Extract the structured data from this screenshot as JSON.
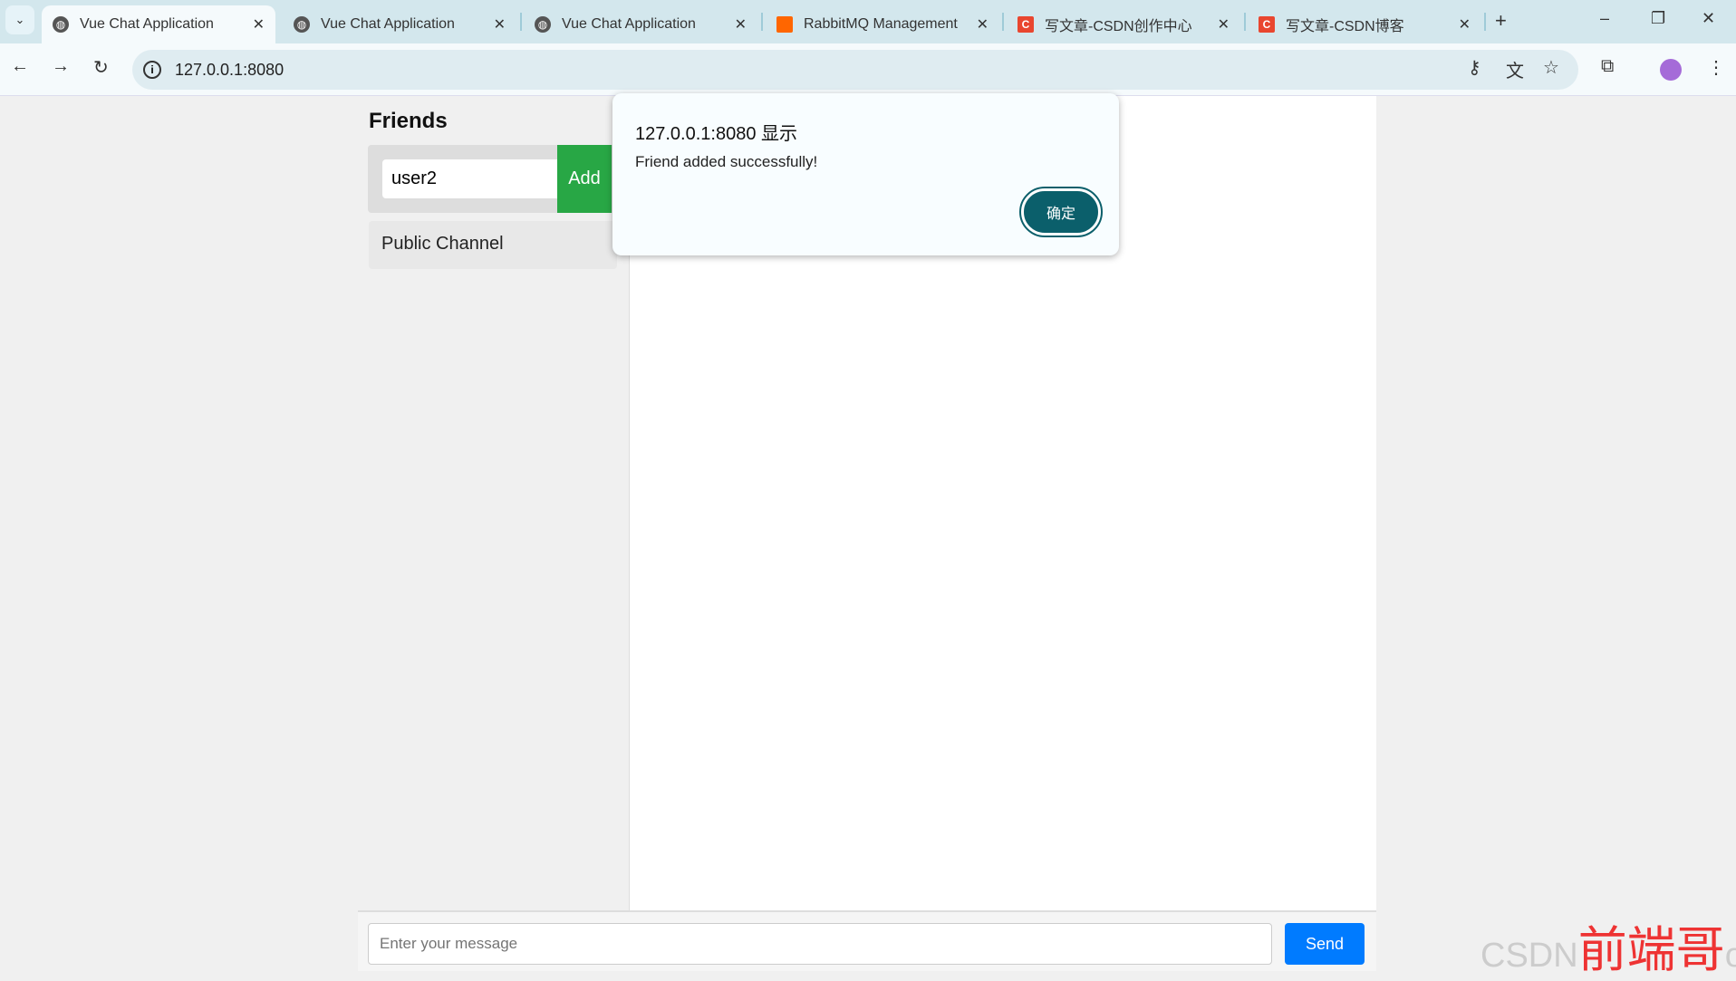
{
  "browser": {
    "tabs": [
      {
        "label": "Vue Chat Application",
        "icon": "globe-icon",
        "active": true
      },
      {
        "label": "Vue Chat Application",
        "icon": "globe-icon"
      },
      {
        "label": "Vue Chat Application",
        "icon": "globe-icon"
      },
      {
        "label": "RabbitMQ Management",
        "icon": "rabbitmq-icon"
      },
      {
        "label": "写文章-CSDN创作中心",
        "icon": "csdn-icon"
      },
      {
        "label": "写文章-CSDN博客",
        "icon": "csdn-icon"
      }
    ],
    "url": "127.0.0.1:8080"
  },
  "sidebar": {
    "title": "Friends",
    "friend_input_value": "user2",
    "add_label": "Add",
    "channels": [
      "Public Channel"
    ]
  },
  "footer": {
    "message_placeholder": "Enter your message",
    "send_label": "Send"
  },
  "dialog": {
    "title": "127.0.0.1:8080 显示",
    "message": "Friend added successfully!",
    "ok_label": "确定"
  },
  "watermark": {
    "prefix": "CSDN",
    "name": "前端哥",
    "suffix": "o"
  },
  "colors": {
    "add": "#28a745",
    "send": "#007bff",
    "dialog_button": "#0b5f6b"
  }
}
